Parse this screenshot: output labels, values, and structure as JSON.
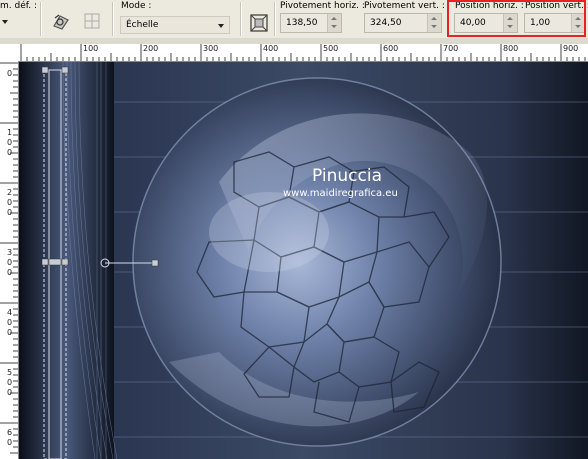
{
  "toolbar": {
    "preset_label": "m. déf. :",
    "mode_label": "Mode :",
    "mode_value": "Échelle",
    "pivot_h_label": "Pivotement horiz. :",
    "pivot_h_value": "138,50",
    "pivot_v_label": "Pivotement vert. :",
    "pivot_v_value": "324,50",
    "pos_h_label": "Position horiz. :",
    "pos_h_value": "40,00",
    "pos_v_label": "Position vert. :",
    "pos_v_value": "1,00"
  },
  "ruler": {
    "h_ticks": [
      "100",
      "200",
      "300",
      "400",
      "500",
      "600",
      "700",
      "800",
      "900"
    ],
    "v_ticks": [
      [
        "0"
      ],
      [
        "1",
        "0",
        "0"
      ],
      [
        "2",
        "0",
        "0"
      ],
      [
        "3",
        "0",
        "0"
      ],
      [
        "4",
        "0",
        "0"
      ],
      [
        "5",
        "0",
        "0"
      ],
      [
        "6",
        "0"
      ]
    ]
  },
  "canvas": {
    "watermark_title": "Pinuccia",
    "watermark_url": "www.maidiregrafica.eu"
  },
  "colors": {
    "highlight": "#e8231f",
    "toolbar_bg": "#ece9df",
    "canvas_dark": "#141a28",
    "canvas_blue": "#8aa0c8"
  }
}
